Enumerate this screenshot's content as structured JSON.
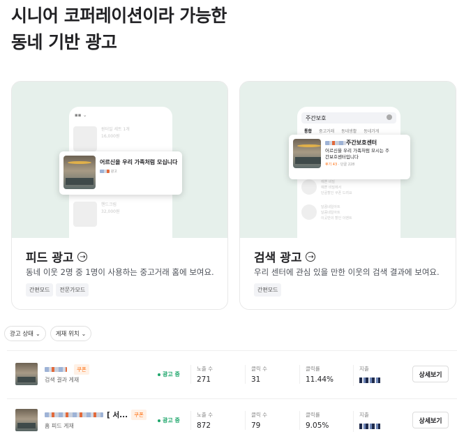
{
  "headline": {
    "line1": "시니어 코퍼레이션이라 가능한",
    "line2": "동네 기반 광고"
  },
  "cards": [
    {
      "title": "피드 광고",
      "desc": "동네 이웃 2명 중 1명이 사용하는 중고거래 홈에 보여요.",
      "tags": [
        "간편모드",
        "전문가모드"
      ],
      "mock": {
        "top_item": {
          "line1": "원터일 세트 1개",
          "line2": "16,000원"
        },
        "popup_title": "어르신을 우리 가족처럼 모십니다",
        "popup_meta": "광고",
        "bottom_item": {
          "line1": "핸드크림",
          "line2": "32,000원"
        }
      }
    },
    {
      "title": "검색 광고",
      "desc": "우리 센터에 관심 있을 만한 이웃의 검색 결과에 보여요.",
      "tags": [
        "간편모드"
      ],
      "mock": {
        "search_query": "주간보호",
        "tabs": [
          "통합",
          "중고거래",
          "동네생활",
          "동네가게"
        ],
        "popup_name_suffix": "주간보호센터",
        "popup_desc": "어르신을 우리 가족처럼 모시는 주간보호센터입니다",
        "popup_meta_orange": "후기 43",
        "popup_meta_rest": "· 단골 228",
        "list_items": [
          {
            "line1": "예쁜 비밀",
            "line2": "예쁜 비밀에서",
            "line3": "단골할인 쿠폰 드려요"
          },
          {
            "line1": "달콤네일아트",
            "line2": "달콤네일아트",
            "line3": "이곳만의 할인 이벤트"
          }
        ]
      }
    }
  ],
  "filters": [
    {
      "label": "광고 상태"
    },
    {
      "label": "게재 위치"
    }
  ],
  "ads": [
    {
      "name_suffix": "",
      "coupon": "쿠폰",
      "placement": "검색 결과 게재",
      "status": "광고 중",
      "impressions_label": "노출 수",
      "impressions": "271",
      "clicks_label": "클릭 수",
      "clicks": "31",
      "ctr_label": "클릭률",
      "ctr": "11.44%",
      "spend_label": "지출",
      "detail": "상세보기"
    },
    {
      "name_suffix": "[ 서...",
      "coupon": "쿠폰",
      "placement": "홈 피드 게재",
      "status": "광고 중",
      "impressions_label": "노출 수",
      "impressions": "872",
      "clicks_label": "클릭 수",
      "clicks": "79",
      "ctr_label": "클릭률",
      "ctr": "9.05%",
      "spend_label": "지출",
      "detail": "상세보기"
    }
  ],
  "colors": {
    "accent_orange": "#ff6f0f",
    "status_green": "#1ea66b",
    "card_bg": "#e6f0eb"
  }
}
